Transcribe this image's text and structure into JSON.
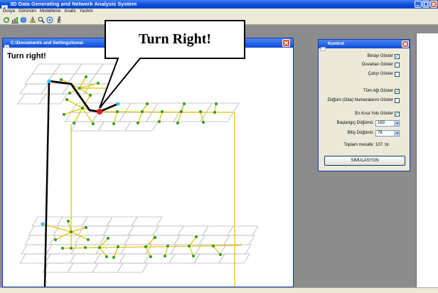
{
  "app": {
    "title": "3D Data Generating and Network Analysis System"
  },
  "menu": [
    "Dosya",
    "Görünüm",
    "Modelleme",
    "Analiz",
    "Yardım"
  ],
  "toolbar": {
    "icons": [
      "refresh-icon",
      "bar-chart-icon",
      "globe-icon",
      "model-3d-icon",
      "zoom-icon",
      "target-icon",
      "walk-icon"
    ]
  },
  "document": {
    "title": "C:\\Documents and Settings\\tuna\\",
    "message": "Turn right!"
  },
  "callout": {
    "text": "Turn Right!"
  },
  "kontrol": {
    "title": "Kontrol",
    "options": [
      {
        "label": "Binayı Göster",
        "checked": true
      },
      {
        "label": "Duvarları Göster",
        "checked": false
      },
      {
        "label": "Çatıyı Göster",
        "checked": false
      },
      {
        "label": "Tüm Ağı Göster",
        "checked": true
      },
      {
        "label": "Düğüm (Oda) Numaralarını Göster",
        "checked": false
      },
      {
        "label": "En Kısa Yolu Göster",
        "checked": true
      }
    ],
    "start_node": {
      "label": "Başlangıç Düğümü:",
      "value": "163"
    },
    "end_node": {
      "label": "Bitiş Düğümü:",
      "value": "76"
    },
    "total_distance": {
      "label": "Toplam mesafe:",
      "value": "107. br."
    },
    "simulate_button": "SIMULASYON"
  },
  "colors": {
    "titlebar": "#0b4bd6",
    "workspace": "#8c8c8c",
    "floor_grid": "#b9b9b9",
    "network": "#e3c600",
    "node": "#2f9c1c",
    "path": "#000000",
    "current_position": "#e8141a",
    "path_endpoint": "#3cc4ec"
  }
}
